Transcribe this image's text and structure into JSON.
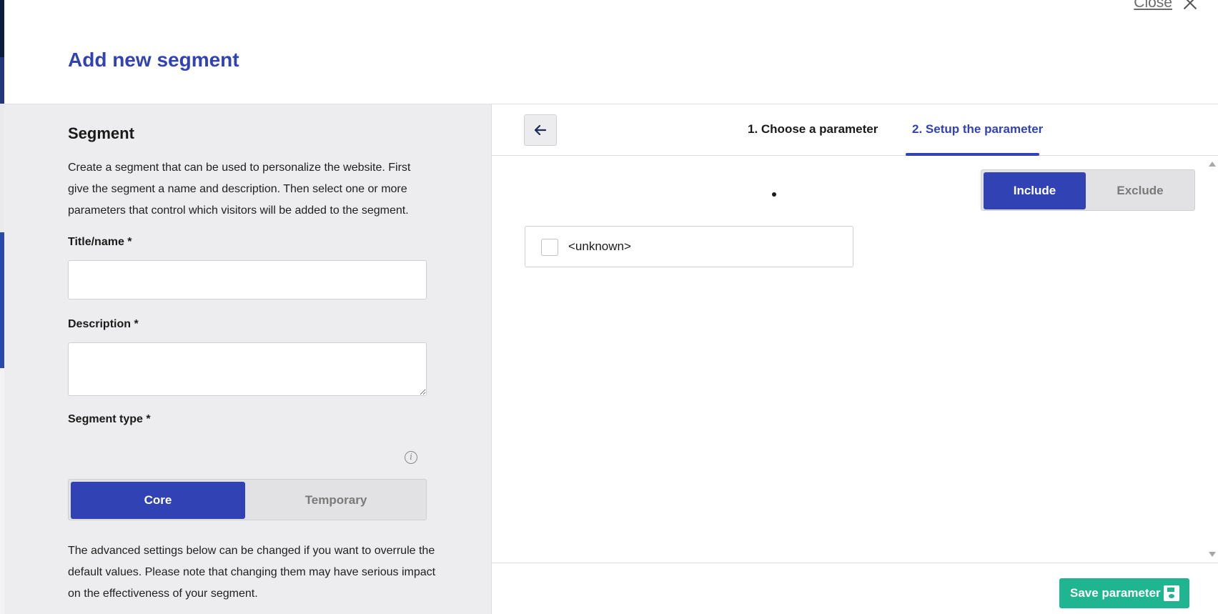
{
  "header": {
    "close_label": "Close",
    "title": "Add new segment"
  },
  "segment_form": {
    "section_title": "Segment",
    "intro": "Create a segment that can be used to personalize the website. First give the segment a name and description. Then select one or more parameters that control which visitors will be added to the segment.",
    "title_label": "Title/name *",
    "title_value": "",
    "description_label": "Description *",
    "description_value": "",
    "segment_type_label": "Segment type *",
    "segment_type_options": [
      "Core",
      "Temporary"
    ],
    "segment_type_selected": "Core",
    "advanced_text": "The advanced settings below can be changed if you want to overrule the default values. Please note that changing them may have serious impact on the effectiveness of your segment."
  },
  "parameter_panel": {
    "tabs": [
      {
        "label": "1. Choose a parameter",
        "active": false
      },
      {
        "label": "2. Setup the parameter",
        "active": true
      }
    ],
    "include_exclude": [
      "Include",
      "Exclude"
    ],
    "include_selected": "Include",
    "values": [
      {
        "label": "<unknown>",
        "checked": false
      }
    ],
    "save_label": "Save parameter"
  },
  "colors": {
    "primary": "#3142b4",
    "save_button": "#1fb591",
    "left_panel_bg": "#ededef"
  }
}
